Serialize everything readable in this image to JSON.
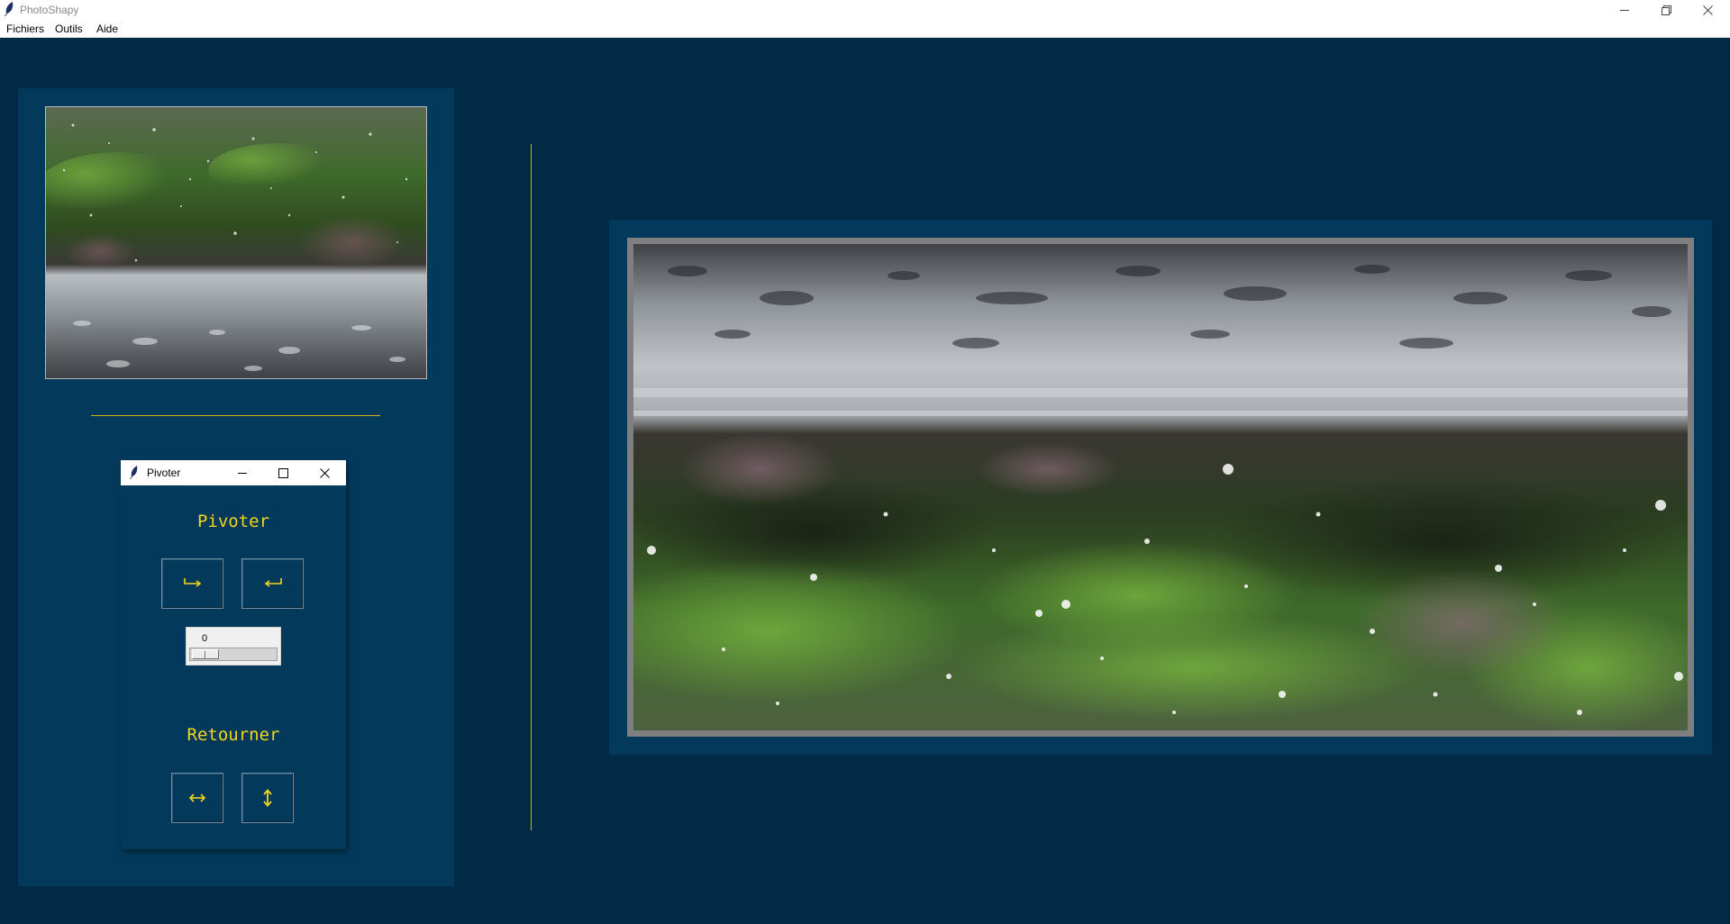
{
  "window": {
    "title": "PhotoShapy",
    "controls": {
      "minimize_icon": "minimize-icon",
      "restore_icon": "restore-icon",
      "close_icon": "close-icon"
    }
  },
  "menu": {
    "items": [
      "Fichiers",
      "Outils",
      "Aide"
    ]
  },
  "colors": {
    "background": "#012a45",
    "panel": "#033a5c",
    "accent": "#f4d51d",
    "divider": "#d6b10c"
  },
  "thumbnail": {
    "description_icon": "rain-photo-thumbnail"
  },
  "tool_window": {
    "title": "Pivoter",
    "rotate_section": {
      "title": "Pivoter",
      "buttons": [
        {
          "label": "⮑",
          "icon": "rotate-right-icon"
        },
        {
          "label": "⮐",
          "icon": "rotate-left-icon"
        }
      ],
      "angle_value": "0",
      "angle_fraction": 0
    },
    "flip_section": {
      "title": "Retourner",
      "buttons": [
        {
          "label": "⇔",
          "icon": "flip-horizontal-icon"
        },
        {
          "label": "⇕",
          "icon": "flip-vertical-icon"
        }
      ]
    }
  },
  "main_image": {
    "icon": "rain-photo-flipped"
  }
}
